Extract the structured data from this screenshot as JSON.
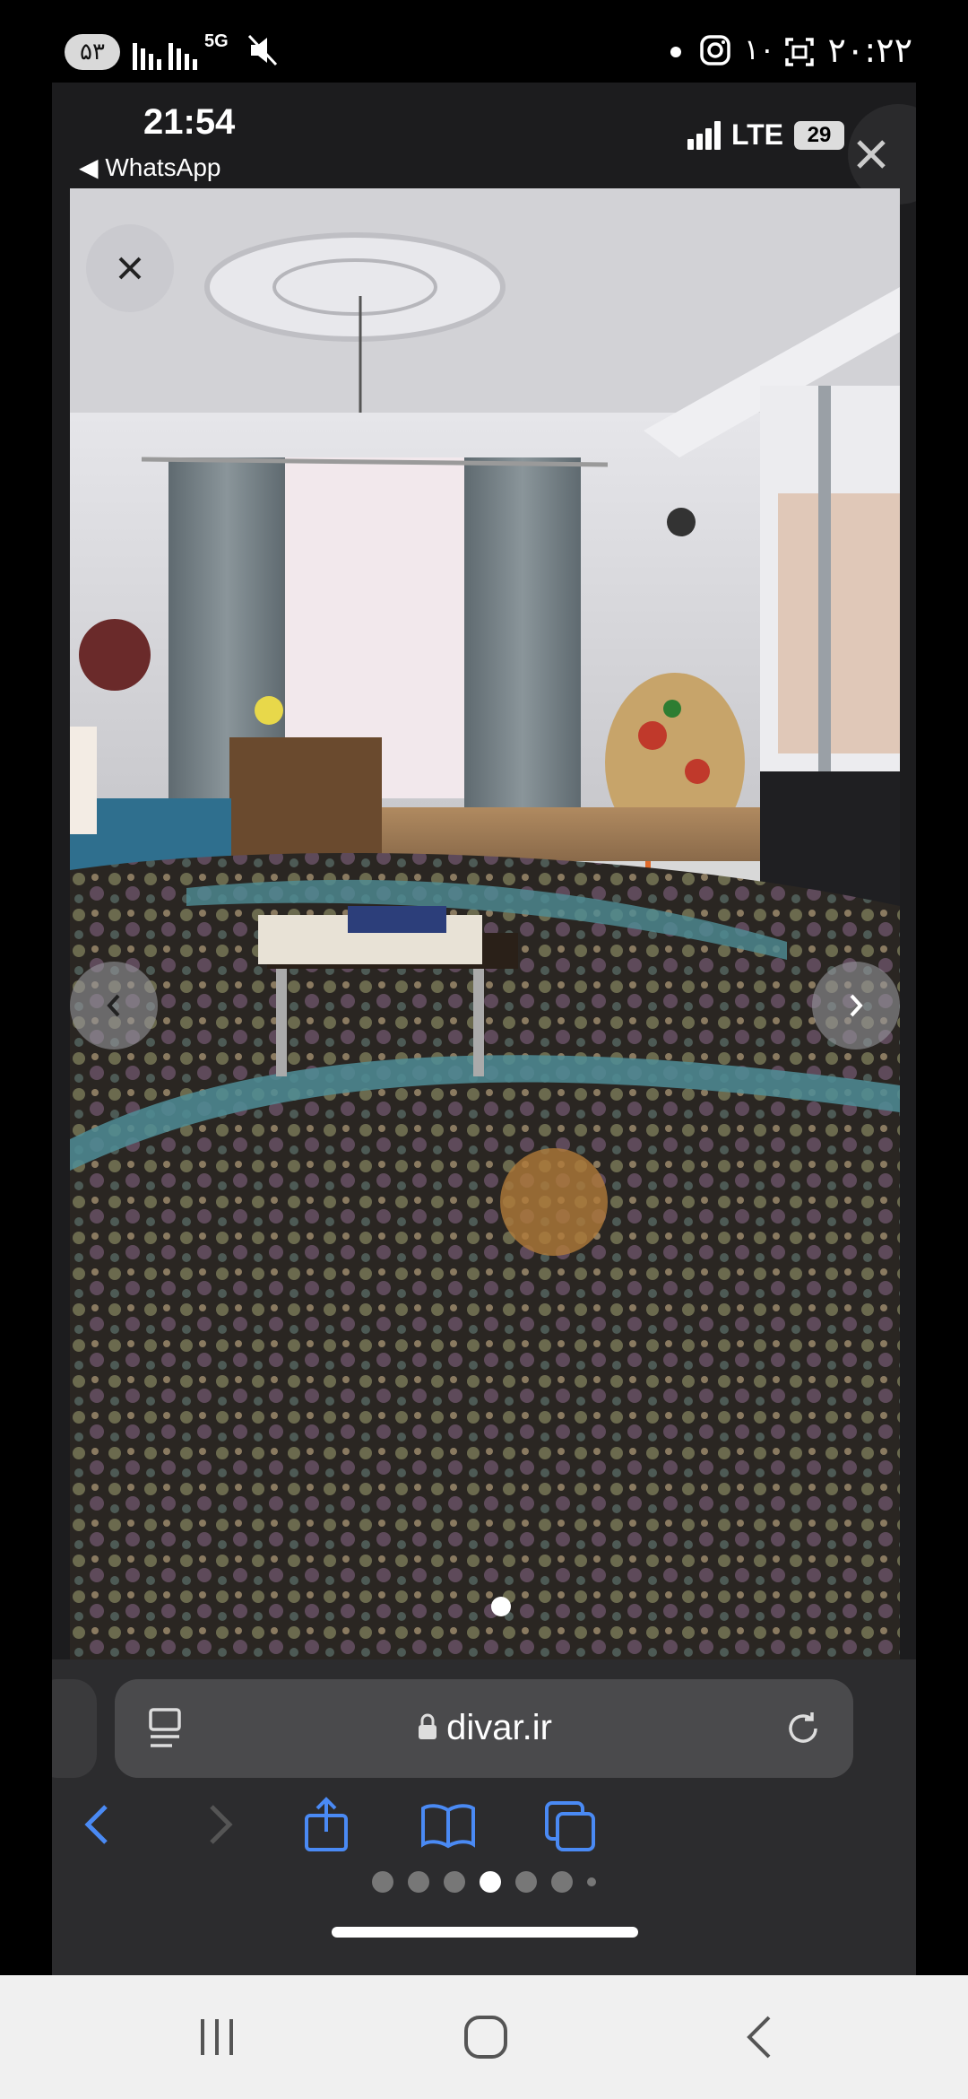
{
  "android_status": {
    "battery": "۵۳",
    "net": "5G",
    "time": "۲۰:۲۲",
    "sim_label": "۱۰"
  },
  "ios_status": {
    "time": "21:54",
    "back_app": "◀ WhatsApp",
    "network": "LTE",
    "battery": "29"
  },
  "browser": {
    "url": "divar.ir",
    "page_dots_total": 7,
    "page_dots_active": 4
  },
  "colors": {
    "ios_blue": "#4a8af4",
    "toolbar_bg": "#2c2c2e",
    "urlbar_bg": "#4a4a4c"
  }
}
